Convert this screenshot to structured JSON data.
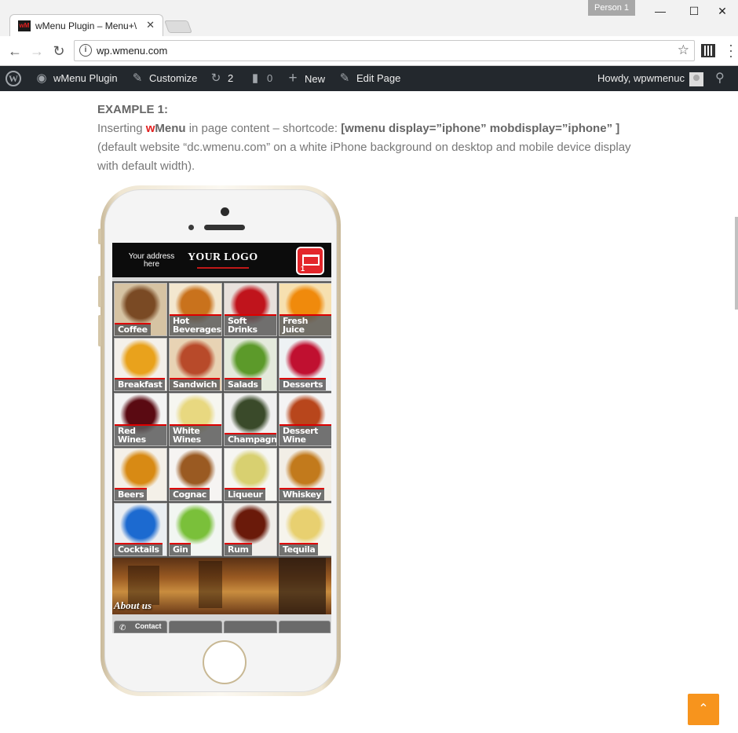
{
  "browser": {
    "person": "Person 1",
    "tab_title": "wMenu Plugin – Menu+\\",
    "tab_favicon_text": "wM",
    "url": "wp.wmenu.com"
  },
  "adminbar": {
    "site": "wMenu Plugin",
    "customize": "Customize",
    "updates": "2",
    "comments": "0",
    "new": "New",
    "edit": "Edit Page",
    "howdy": "Howdy, wpwmenuc"
  },
  "content": {
    "example": "EXAMPLE 1:",
    "line1_a": "Inserting ",
    "line1_w": "w",
    "line1_menu": "Menu",
    "line1_b": " in page content – shortcode: ",
    "line1_code": "[wmenu display=”iphone” mobdisplay=”iphone” ]",
    "line2": "(default website “dc.wmenu.com” on a white iPhone background on desktop and mobile device display with default width)."
  },
  "app": {
    "address": "Your address here",
    "logo": "YOUR LOGO",
    "cart_count": "1",
    "items": [
      {
        "label": "Coffee",
        "color": "#d6c3a3",
        "accent": "#7a4a24"
      },
      {
        "label": "Hot Beverages",
        "color": "#f3e7cf",
        "accent": "#c9721c"
      },
      {
        "label": "Soft Drinks",
        "color": "#e8e1dc",
        "accent": "#c0141c"
      },
      {
        "label": "Fresh Juice",
        "color": "#f6e0b0",
        "accent": "#f08a0c"
      },
      {
        "label": "Breakfast",
        "color": "#f4f0ea",
        "accent": "#e9a21c"
      },
      {
        "label": "Sandwich",
        "color": "#e8d3b4",
        "accent": "#b84a2a"
      },
      {
        "label": "Salads",
        "color": "#e4eadc",
        "accent": "#5c9a2a"
      },
      {
        "label": "Desserts",
        "color": "#eef2f4",
        "accent": "#c01030"
      },
      {
        "label": "Red Wines",
        "color": "#f4f4f4",
        "accent": "#5a0a12"
      },
      {
        "label": "White Wines",
        "color": "#f6f6f0",
        "accent": "#e8d880"
      },
      {
        "label": "Champagne",
        "color": "#f0f0f0",
        "accent": "#3a4a2a"
      },
      {
        "label": "Dessert Wine",
        "color": "#f4f4f4",
        "accent": "#b8461c"
      },
      {
        "label": "Beers",
        "color": "#f4f0e8",
        "accent": "#d88a14"
      },
      {
        "label": "Cognac",
        "color": "#f6f4f2",
        "accent": "#9a5a22"
      },
      {
        "label": "Liqueur",
        "color": "#f6f6f2",
        "accent": "#d8d070"
      },
      {
        "label": "Whiskey",
        "color": "#f2eee6",
        "accent": "#c27a1c"
      },
      {
        "label": "Cocktails",
        "color": "#eaeef2",
        "accent": "#1c6ad0"
      },
      {
        "label": "Gin",
        "color": "#f2f6f2",
        "accent": "#7ac03a"
      },
      {
        "label": "Rum",
        "color": "#f0eeea",
        "accent": "#6a1a0a"
      },
      {
        "label": "Tequila",
        "color": "#f6f4ec",
        "accent": "#e8d070"
      }
    ],
    "about": "About us",
    "contact": "Contact"
  }
}
